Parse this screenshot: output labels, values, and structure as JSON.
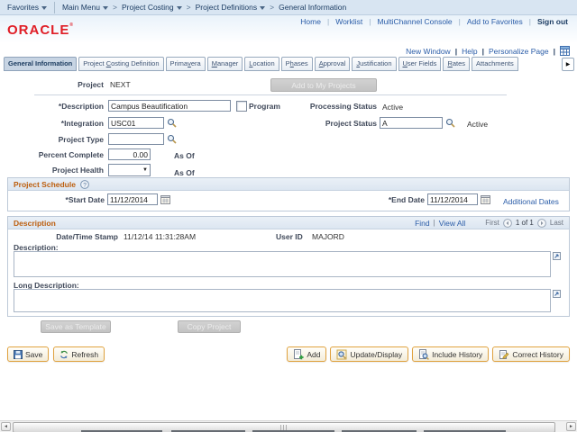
{
  "breadcrumb": {
    "favorites": "Favorites",
    "separator": ">",
    "items": [
      "Main Menu",
      "Project Costing",
      "Project Definitions",
      "General Information"
    ]
  },
  "portal_links": {
    "home": "Home",
    "worklist": "Worklist",
    "multichannel": "MultiChannel Console",
    "add_to_favorites": "Add to Favorites",
    "sign_out": "Sign out"
  },
  "logo": {
    "text": "ORACLE",
    "mark": "®"
  },
  "utility_links": {
    "new_window": "New Window",
    "help": "Help",
    "personalize": "Personalize Page"
  },
  "tabs": [
    {
      "label": "General Information",
      "active": true
    },
    {
      "label": "Project Costing Definition",
      "key": "C",
      "active": false
    },
    {
      "label": "Primavera",
      "key": "v",
      "active": false
    },
    {
      "label": "Manager",
      "key": "M",
      "active": false
    },
    {
      "label": "Location",
      "key": "L",
      "active": false
    },
    {
      "label": "Phases",
      "key": "h",
      "active": false
    },
    {
      "label": "Approval",
      "key": "A",
      "active": false
    },
    {
      "label": "Justification",
      "key": "J",
      "active": false
    },
    {
      "label": "User Fields",
      "key": "U",
      "active": false
    },
    {
      "label": "Rates",
      "key": "R",
      "active": false
    },
    {
      "label": "Attachments",
      "active": false
    }
  ],
  "form": {
    "project_label": "Project",
    "project_value": "NEXT",
    "add_to_my_projects": "Add to My Projects",
    "description_label": "*Description",
    "description_value": "Campus Beautification",
    "program_label": "Program",
    "integration_label": "*Integration",
    "integration_value": "USC01",
    "project_type_label": "Project Type",
    "project_type_value": "",
    "percent_complete_label": "Percent Complete",
    "percent_complete_value": "0.00",
    "as_of_label": "As Of",
    "project_health_label": "Project Health",
    "processing_status_label": "Processing Status",
    "processing_status_value": "Active",
    "project_status_label": "Project Status",
    "project_status_value": "A",
    "project_status_text": "Active"
  },
  "schedule": {
    "title": "Project Schedule",
    "start_date_label": "*Start Date",
    "start_date_value": "11/12/2014",
    "end_date_label": "*End Date",
    "end_date_value": "11/12/2014",
    "additional_dates": "Additional Dates"
  },
  "description_section": {
    "title": "Description",
    "find": "Find",
    "view_all": "View All",
    "first": "First",
    "page": "1 of 1",
    "last": "Last",
    "datetime_label": "Date/Time Stamp",
    "datetime_value": "11/12/14 11:31:28AM",
    "user_id_label": "User ID",
    "user_id_value": "MAJORD",
    "description_label": "Description:",
    "description_value": "",
    "long_description_label": "Long Description:",
    "long_description_value": ""
  },
  "actions": {
    "save_as_template": "Save as Template",
    "copy_project": "Copy Project",
    "save": "Save",
    "refresh": "Refresh",
    "add": "Add",
    "update_display": "Update/Display",
    "include_history": "Include History",
    "correct_history": "Correct History"
  },
  "icons": {
    "tab_scroll_right": "▶",
    "scrollbar_left": "◄",
    "scrollbar_right": "►",
    "select_arrow": "▼",
    "help": "?"
  },
  "colors": {
    "link": "#2b5da8",
    "logo_red": "#e01e26",
    "section_title": "#bc5d0c",
    "topbar_bg": "#d8e5f2",
    "button_border": "#e0a23f",
    "label": "#40495a"
  }
}
